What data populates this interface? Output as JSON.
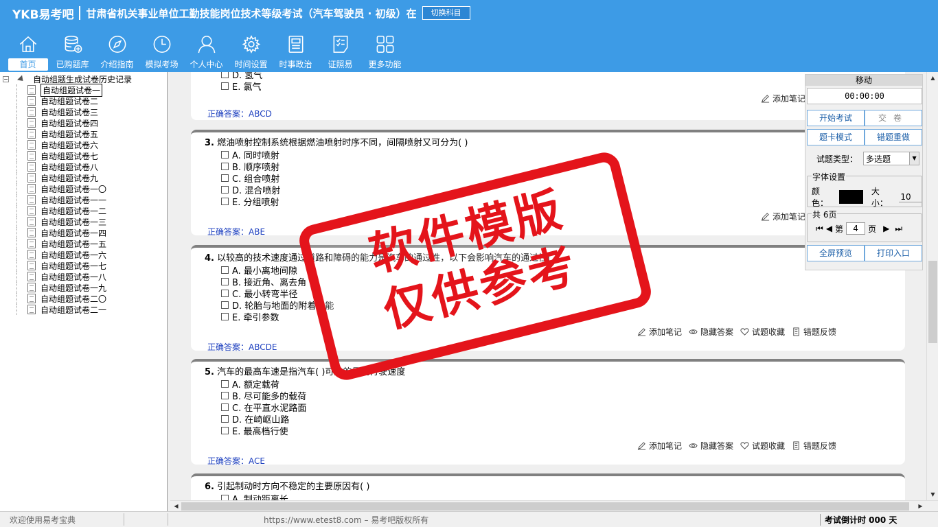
{
  "header": {
    "logo": "YKB易考吧",
    "title": "甘肃省机关事业单位工勤技能岗位技术等级考试（汽车驾驶员 · 初级）在",
    "switch_label": "切换科目"
  },
  "nav": [
    {
      "label": "首页",
      "icon": "home-icon"
    },
    {
      "label": "已购题库",
      "icon": "database-icon"
    },
    {
      "label": "介绍指南",
      "icon": "compass-icon"
    },
    {
      "label": "模拟考场",
      "icon": "clock-icon"
    },
    {
      "label": "个人中心",
      "icon": "user-icon"
    },
    {
      "label": "时间设置",
      "icon": "gear-icon"
    },
    {
      "label": "时事政治",
      "icon": "news-icon"
    },
    {
      "label": "证照易",
      "icon": "certificate-icon"
    },
    {
      "label": "更多功能",
      "icon": "grid-icon"
    }
  ],
  "tree": {
    "root": "自动组题生成试卷历史记录",
    "items": [
      "自动组题试卷一",
      "自动组题试卷二",
      "自动组题试卷三",
      "自动组题试卷四",
      "自动组题试卷五",
      "自动组题试卷六",
      "自动组题试卷七",
      "自动组题试卷八",
      "自动组题试卷九",
      "自动组题试卷一〇",
      "自动组题试卷一一",
      "自动组题试卷一二",
      "自动组题试卷一三",
      "自动组题试卷一四",
      "自动组题试卷一五",
      "自动组题试卷一六",
      "自动组题试卷一七",
      "自动组题试卷一八",
      "自动组题试卷一九",
      "自动组题试卷二〇",
      "自动组题试卷二一"
    ]
  },
  "actions": {
    "note": "添加笔记",
    "hide": "隐藏答案",
    "fav": "试题收藏",
    "report": "错题反馈",
    "report_cut": "错"
  },
  "answer_label": "正确答案：",
  "questions": [
    {
      "num": "",
      "text": "",
      "options": [
        "D. 氢气",
        "E. 氯气"
      ],
      "answer": "ABCD"
    },
    {
      "num": "3.",
      "text": "燃油喷射控制系统根据燃油喷射时序不同，间隔喷射又可分为( )",
      "options": [
        "A. 同时喷射",
        "B. 顺序喷射",
        "C. 组合喷射",
        "D. 混合喷射",
        "E. 分组喷射"
      ],
      "answer": "ABE"
    },
    {
      "num": "4.",
      "text": "以较高的技术速度通过道路和障碍的能力是汽车的通过性，以下会影响汽车的通过性(  )",
      "options": [
        "A. 最小离地间隙",
        "B. 接近角、离去角",
        "C. 最小转弯半径",
        "D. 轮胎与地面的附着性能",
        "E. 牵引参数"
      ],
      "answer": "ABCDE"
    },
    {
      "num": "5.",
      "text": "汽车的最高车速是指汽车( )可达的最高行驶速度",
      "options": [
        "A. 额定载荷",
        "B. 尽可能多的载荷",
        "C. 在平直水泥路面",
        "D. 在崎岖山路",
        "E. 最高档行使"
      ],
      "answer": "ACE"
    },
    {
      "num": "6.",
      "text": "引起制动时方向不稳定的主要原因有( )",
      "options": [
        "A. 制动距离长"
      ],
      "answer": ""
    }
  ],
  "panel": {
    "move": "移动",
    "timer": "00:00:00",
    "start": "开始考试",
    "submit": "交卷",
    "card_mode": "题卡模式",
    "redo": "错题重做",
    "type_label": "试题类型：",
    "type_value": "多选题",
    "font_group": "字体设置",
    "color_label": "颜色：",
    "size_label": "大小：",
    "size_value": "10",
    "page_group": "共 6页",
    "page_prefix": "第",
    "page_value": "4",
    "page_suffix": "页",
    "fullscreen": "全屏预览",
    "print": "打印入口"
  },
  "status": {
    "welcome": "欢迎使用易考宝典",
    "site": "https://www.etest8.com – 易考吧版权所有",
    "countdown": "考试倒计时 000 天"
  },
  "stamp": {
    "line1": "软件模版",
    "line2": "仅供参考"
  },
  "colors": {
    "header_bg": "#3d9be6",
    "answer_text": "#1c3fbf",
    "stamp_red": "#e4141b"
  }
}
